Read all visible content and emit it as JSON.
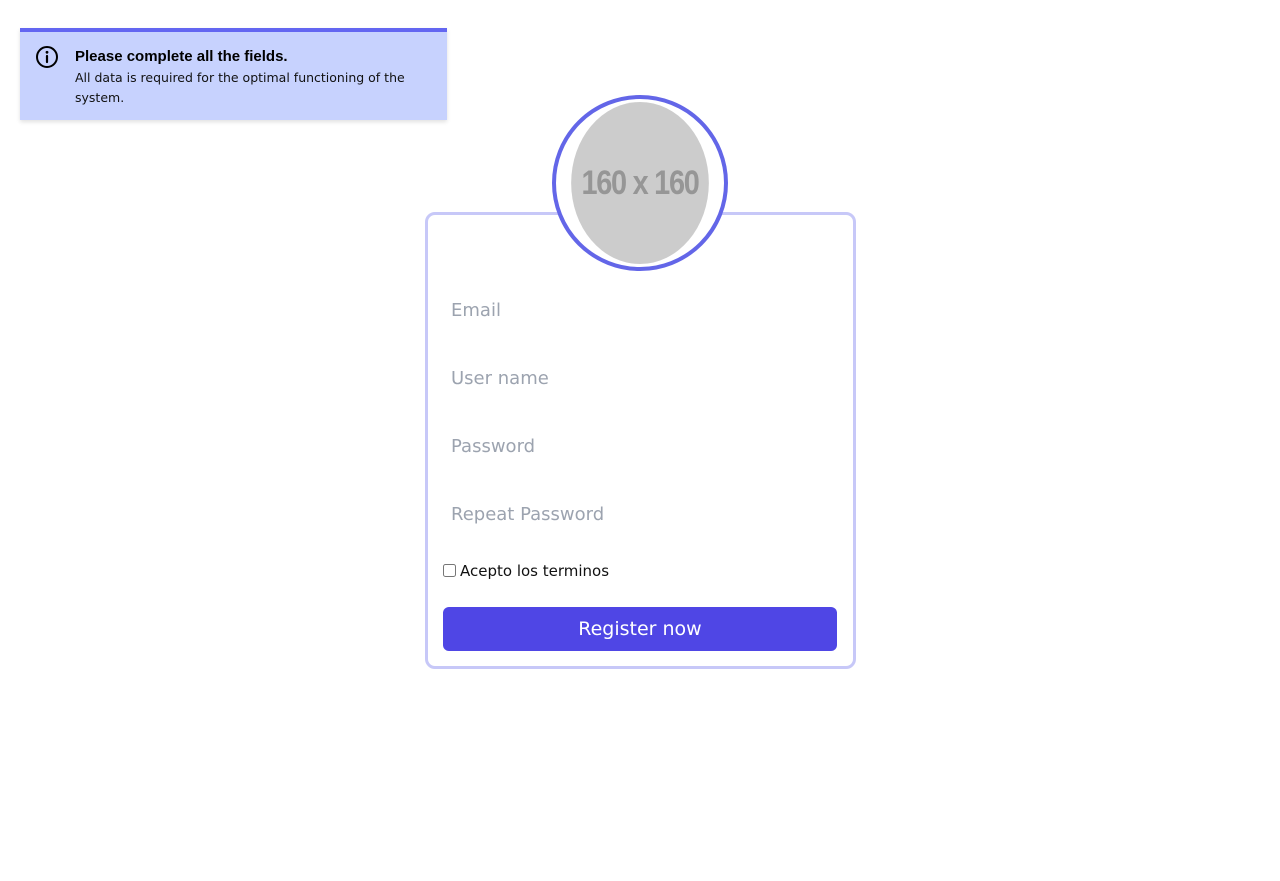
{
  "alert": {
    "icon": "info-circle-icon",
    "title": "Please complete all the fields.",
    "message": "All data is required for the optimal functioning of the system.",
    "background_color": "#c7d2fe",
    "accent_color": "#6366f1"
  },
  "avatar": {
    "placeholder_text": "160 x 160"
  },
  "form": {
    "email_placeholder": "Email",
    "username_placeholder": "User name",
    "password_placeholder": "Password",
    "repeat_password_placeholder": "Repeat Password",
    "terms_label": "Acepto los terminos",
    "terms_checked": false,
    "submit_label": "Register now",
    "button_color": "#4f46e5",
    "card_border_color": "#c7c8f8"
  }
}
